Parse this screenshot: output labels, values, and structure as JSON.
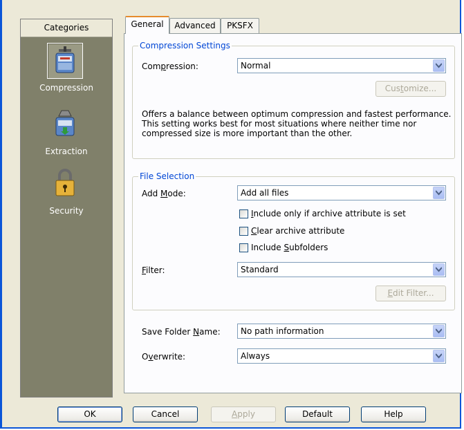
{
  "sidebar": {
    "header": "Categories",
    "items": [
      {
        "label": "Compression",
        "icon": "compression-icon",
        "selected": true
      },
      {
        "label": "Extraction",
        "icon": "extraction-icon",
        "selected": false
      },
      {
        "label": "Security",
        "icon": "lock-icon",
        "selected": false
      }
    ]
  },
  "tabs": [
    {
      "label": "General",
      "active": true
    },
    {
      "label": "Advanced",
      "active": false
    },
    {
      "label": "PKSFX",
      "active": false
    }
  ],
  "compression_settings": {
    "title": "Compression Settings",
    "compression_label_pre": "Com",
    "compression_label_u": "p",
    "compression_label_post": "ression:",
    "compression_value": "Normal",
    "customize_pre": "Cus",
    "customize_u": "t",
    "customize_post": "omize...",
    "description": "Offers a balance between optimum compression and fastest performance. This setting works best for most situations where neither time nor compressed size is more important than the other."
  },
  "file_selection": {
    "title": "File Selection",
    "add_mode_pre": "Add ",
    "add_mode_u": "M",
    "add_mode_post": "ode:",
    "add_mode_value": "Add all files",
    "chk1_u": "I",
    "chk1_post": "nclude only if archive attribute is set",
    "chk2_u": "C",
    "chk2_post": "lear archive attribute",
    "chk3_pre": "Include ",
    "chk3_u": "S",
    "chk3_post": "ubfolders",
    "filter_u": "F",
    "filter_post": "ilter:",
    "filter_value": "Standard",
    "edit_filter_u": "E",
    "edit_filter_post": "dit Filter..."
  },
  "save_folder": {
    "label_pre": "Save Folder ",
    "label_u": "N",
    "label_post": "ame:",
    "value": "No path information"
  },
  "overwrite": {
    "label_pre": "O",
    "label_u": "v",
    "label_post": "erwrite:",
    "value": "Always"
  },
  "buttons": {
    "ok": "OK",
    "cancel": "Cancel",
    "apply_u": "A",
    "apply_post": "pply",
    "default": "Default",
    "help": "Help"
  },
  "colors": {
    "window_border": "#0a55d8",
    "sidebar_bg": "#80806a",
    "group_title": "#0046d5",
    "tab_accent": "#e68b2c"
  }
}
